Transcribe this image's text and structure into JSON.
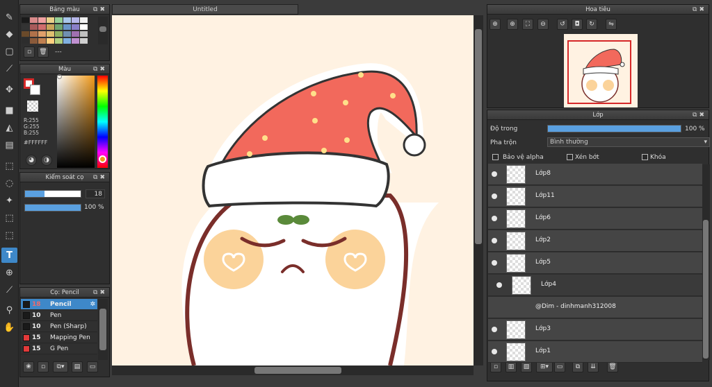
{
  "document": {
    "tab_title": "Untitled"
  },
  "palette_panel": {
    "title": "Bảng màu",
    "footer_text": "---",
    "swatches": [
      "#1a1a1a",
      "#d98a8a",
      "#f0a0a0",
      "#e9d18a",
      "#96cf95",
      "#a8c6ea",
      "#b6b6e9",
      "#f2f2f2",
      "#333333",
      "#a85a5a",
      "#d06d6d",
      "#c9a55a",
      "#6fa56f",
      "#6a95c8",
      "#8a7fc8",
      "#ffffff",
      "#6a4a2a",
      "#b0724a",
      "#e0a06a",
      "#e0c070",
      "#90b060",
      "#7090b0",
      "#a070b0",
      "#c0c0c0",
      "#2d2d2d",
      "#8a5a3a",
      "#c08050",
      "#ffd080",
      "#b0d080",
      "#80b0e0",
      "#c090d0",
      "#d0d0d0"
    ]
  },
  "color_panel": {
    "title": "Màu",
    "rgb": {
      "r": "R:255",
      "g": "G:255",
      "b": "B:255"
    },
    "hex": "#FFFFFF"
  },
  "brush_control": {
    "title": "Kiểm soát cọ",
    "size": "18",
    "opacity": "100 %",
    "size_fraction": 0.35,
    "opacity_fraction": 1.0
  },
  "brush_panel": {
    "title": "Cọ: Pencil",
    "brushes": [
      {
        "size": "18",
        "name": "Pencil",
        "color": "#1a1a1a",
        "active": true
      },
      {
        "size": "10",
        "name": "Pen",
        "color": "#1a1a1a"
      },
      {
        "size": "10",
        "name": "Pen (Sharp)",
        "color": "#1a1a1a"
      },
      {
        "size": "15",
        "name": "Mapping Pen",
        "color": "#e23a3a"
      },
      {
        "size": "15",
        "name": "G Pen",
        "color": "#e23a3a"
      }
    ]
  },
  "navigator": {
    "title": "Hoa tiêu"
  },
  "layer_panel": {
    "title": "Lớp",
    "opacity_label": "Độ trong",
    "opacity_value": "100 %",
    "opacity_fraction": 1.0,
    "blend_label": "Pha trộn",
    "blend_value": "Bình thường",
    "protect_alpha": "Bảo vệ alpha",
    "clipping": "Xén bớt",
    "lock": "Khóa",
    "layers": [
      {
        "name": "Lớp8"
      },
      {
        "name": "Lớp11"
      },
      {
        "name": "Lớp6"
      },
      {
        "name": "Lớp2"
      },
      {
        "name": "Lớp5"
      },
      {
        "name": "Lớp4"
      },
      {
        "name": "@Dim - dinhmanh312008"
      },
      {
        "name": "Lớp3"
      },
      {
        "name": "Lớp1"
      }
    ]
  },
  "colors": {
    "accent": "#3e88c9",
    "hat": "#f2695c",
    "background": "#fff2e2",
    "cheek": "#fbd39a",
    "outline": "#7a2e2a"
  }
}
